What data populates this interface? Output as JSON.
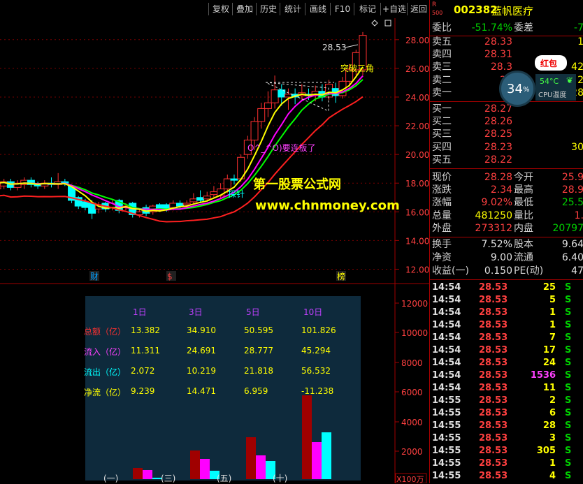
{
  "toolbar": {
    "buttons": [
      "复权",
      "叠加",
      "历史",
      "统计",
      "画线",
      "F10",
      "标记",
      "+自选",
      "返回"
    ]
  },
  "stock": {
    "prefix": "R",
    "code": "002382",
    "name": "蓝帆医疗",
    "sub": "500"
  },
  "price_axis": [
    "28.00",
    "26.00",
    "24.00",
    "22.00",
    "20.00",
    "18.00",
    "16.00",
    "14.00",
    "12.00"
  ],
  "vol_axis": [
    "12000",
    "10000",
    "8000",
    "6000",
    "4000",
    "2000"
  ],
  "vol_unit": "X100万",
  "annotations": {
    "high_price": "28.53",
    "breakout": "突破三角",
    "emoticon": "O^_^O)要连板了",
    "probe": "探针",
    "markers": [
      "财",
      "$",
      "榜"
    ]
  },
  "watermark": {
    "cn": "第一股票公式网",
    "url": "www.chnmoney.com"
  },
  "fund_table": {
    "headers": [
      "1日",
      "3日",
      "5日",
      "10日"
    ],
    "rows": [
      {
        "label": "总额（亿）",
        "values": [
          "13.382",
          "34.910",
          "50.595",
          "101.826"
        ]
      },
      {
        "label": "流入（亿）",
        "values": [
          "11.311",
          "24.691",
          "28.777",
          "45.294"
        ]
      },
      {
        "label": "流出（亿）",
        "values": [
          "2.072",
          "10.219",
          "21.818",
          "56.532"
        ]
      },
      {
        "label": "净流（亿）",
        "values": [
          "9.239",
          "14.471",
          "6.959",
          "-11.238"
        ]
      }
    ],
    "groups": [
      "(一)",
      "(三)",
      "(五)",
      "(十)"
    ],
    "bars": [
      {
        "total": 13.382,
        "inflow": 11.311,
        "outflow": 2.072
      },
      {
        "total": 34.91,
        "inflow": 24.691,
        "outflow": 10.219
      },
      {
        "total": 50.595,
        "inflow": 28.777,
        "outflow": 21.818
      },
      {
        "total": 101.826,
        "inflow": 45.294,
        "outflow": 56.532
      }
    ]
  },
  "quote": {
    "weibi_label": "委比",
    "weibi": "-51.74%",
    "weicha_label": "委差",
    "weicha": "-7",
    "asks": [
      {
        "label": "卖五",
        "price": "28.33",
        "vol": "1"
      },
      {
        "label": "卖四",
        "price": "28.31",
        "vol": ""
      },
      {
        "label": "卖三",
        "price": "28.3",
        "vol": "42"
      },
      {
        "label": "卖二",
        "price": "28",
        "vol": "2"
      },
      {
        "label": "卖一",
        "price": "28",
        "vol": "28"
      }
    ],
    "bids": [
      {
        "label": "买一",
        "price": "28.27",
        "vol": ""
      },
      {
        "label": "买二",
        "price": "28.26",
        "vol": ""
      },
      {
        "label": "买三",
        "price": "28.25",
        "vol": ""
      },
      {
        "label": "买四",
        "price": "28.23",
        "vol": "30"
      },
      {
        "label": "买五",
        "price": "28.22",
        "vol": ""
      }
    ],
    "stats": [
      {
        "l1": "现价",
        "v1": "28.28",
        "l2": "今开",
        "v2": "25.9"
      },
      {
        "l1": "涨跌",
        "v1": "2.34",
        "l2": "最高",
        "v2": "28.9"
      },
      {
        "l1": "涨幅",
        "v1": "9.02%",
        "l2": "最低",
        "v2": "25.5"
      },
      {
        "l1": "总量",
        "v1": "481250",
        "l2": "量比",
        "v2": "1."
      },
      {
        "l1": "外盘",
        "v1": "273312",
        "l2": "内盘",
        "v2": "20797"
      }
    ],
    "stats2": [
      {
        "l1": "换手",
        "v1": "7.52%",
        "l2": "股本",
        "v2": "9.64"
      },
      {
        "l1": "净资",
        "v1": "9.00",
        "l2": "流通",
        "v2": "6.40"
      },
      {
        "l1": "收益(一)",
        "v1": "0.150",
        "l2": "PE(动)",
        "v2": "47"
      }
    ]
  },
  "overlay": {
    "cpu_percent": "34",
    "cpu_unit": "%",
    "temp": "54°C",
    "temp_label": "CPU温度",
    "hongbao": "红包"
  },
  "ticks": [
    {
      "time": "14:54",
      "price": "28.53",
      "vol": "25",
      "bs": "S"
    },
    {
      "time": "14:54",
      "price": "28.53",
      "vol": "5",
      "bs": "S"
    },
    {
      "time": "14:54",
      "price": "28.53",
      "vol": "1",
      "bs": "S"
    },
    {
      "time": "14:54",
      "price": "28.53",
      "vol": "1",
      "bs": "S"
    },
    {
      "time": "14:54",
      "price": "28.53",
      "vol": "7",
      "bs": "S"
    },
    {
      "time": "14:54",
      "price": "28.53",
      "vol": "17",
      "bs": "S"
    },
    {
      "time": "14:54",
      "price": "28.53",
      "vol": "24",
      "bs": "S"
    },
    {
      "time": "14:54",
      "price": "28.53",
      "vol": "1536",
      "bs": "S"
    },
    {
      "time": "14:54",
      "price": "28.53",
      "vol": "11",
      "bs": "S"
    },
    {
      "time": "14:55",
      "price": "28.53",
      "vol": "2",
      "bs": "S"
    },
    {
      "time": "14:55",
      "price": "28.53",
      "vol": "6",
      "bs": "S"
    },
    {
      "time": "14:55",
      "price": "28.53",
      "vol": "28",
      "bs": "S"
    },
    {
      "time": "14:55",
      "price": "28.53",
      "vol": "3",
      "bs": "S"
    },
    {
      "time": "14:55",
      "price": "28.53",
      "vol": "305",
      "bs": "S"
    },
    {
      "time": "14:55",
      "price": "28.53",
      "vol": "1",
      "bs": "S"
    },
    {
      "time": "14:55",
      "price": "28.53",
      "vol": "4",
      "bs": "S"
    }
  ],
  "colors": {
    "up": "#ff3030",
    "down": "#00ffff",
    "ma5": "#ffffff",
    "ma10": "#ffff00",
    "ma20": "#ff00ff",
    "ma30": "#00ff00"
  },
  "chart_data": {
    "type": "candlestick",
    "ylim": [
      11,
      29.5
    ],
    "candles": [
      {
        "o": 17.6,
        "c": 18.0,
        "h": 18.4,
        "l": 17.4
      },
      {
        "o": 17.8,
        "c": 18.1,
        "h": 18.3,
        "l": 17.6
      },
      {
        "o": 18.1,
        "c": 17.7,
        "h": 18.3,
        "l": 17.5
      },
      {
        "o": 17.7,
        "c": 18.0,
        "h": 18.2,
        "l": 17.5
      },
      {
        "o": 17.9,
        "c": 18.2,
        "h": 18.4,
        "l": 17.6
      },
      {
        "o": 18.2,
        "c": 17.9,
        "h": 18.4,
        "l": 17.7
      },
      {
        "o": 17.9,
        "c": 17.8,
        "h": 18.1,
        "l": 17.6
      },
      {
        "o": 17.8,
        "c": 18.0,
        "h": 18.2,
        "l": 17.6
      },
      {
        "o": 18.0,
        "c": 17.9,
        "h": 18.4,
        "l": 17.7
      },
      {
        "o": 17.9,
        "c": 18.1,
        "h": 18.7,
        "l": 17.6
      },
      {
        "o": 18.1,
        "c": 18.0,
        "h": 18.3,
        "l": 17.8
      },
      {
        "o": 17.8,
        "c": 16.8,
        "h": 17.9,
        "l": 16.6
      },
      {
        "o": 17.0,
        "c": 16.4,
        "h": 17.1,
        "l": 16.2
      },
      {
        "o": 16.7,
        "c": 16.3,
        "h": 16.9,
        "l": 16.1
      },
      {
        "o": 16.6,
        "c": 15.9,
        "h": 16.8,
        "l": 15.5
      },
      {
        "o": 16.2,
        "c": 16.5,
        "h": 16.7,
        "l": 15.9
      },
      {
        "o": 16.6,
        "c": 16.2,
        "h": 16.7,
        "l": 16.0
      },
      {
        "o": 16.3,
        "c": 16.6,
        "h": 16.8,
        "l": 16.1
      },
      {
        "o": 16.8,
        "c": 16.1,
        "h": 16.9,
        "l": 15.9
      },
      {
        "o": 16.3,
        "c": 16.4,
        "h": 16.6,
        "l": 16.1
      },
      {
        "o": 16.6,
        "c": 15.8,
        "h": 16.7,
        "l": 15.6
      },
      {
        "o": 15.8,
        "c": 16.0,
        "h": 16.2,
        "l": 15.6
      },
      {
        "o": 16.3,
        "c": 15.9,
        "h": 16.5,
        "l": 15.7
      },
      {
        "o": 16.0,
        "c": 16.4,
        "h": 16.5,
        "l": 15.8
      },
      {
        "o": 16.5,
        "c": 16.2,
        "h": 16.6,
        "l": 16.0
      },
      {
        "o": 16.5,
        "c": 16.2,
        "h": 16.6,
        "l": 16.0
      },
      {
        "o": 16.3,
        "c": 16.6,
        "h": 16.8,
        "l": 16.1
      },
      {
        "o": 16.6,
        "c": 16.4,
        "h": 16.8,
        "l": 16.2
      },
      {
        "o": 16.5,
        "c": 16.6,
        "h": 16.8,
        "l": 16.3
      },
      {
        "o": 16.7,
        "c": 16.9,
        "h": 17.3,
        "l": 16.5
      },
      {
        "o": 17.0,
        "c": 16.8,
        "h": 17.5,
        "l": 16.6
      },
      {
        "o": 16.9,
        "c": 17.1,
        "h": 17.4,
        "l": 16.7
      },
      {
        "o": 17.2,
        "c": 17.4,
        "h": 17.8,
        "l": 17.0
      },
      {
        "o": 17.1,
        "c": 17.6,
        "h": 18.0,
        "l": 16.9
      },
      {
        "o": 17.6,
        "c": 18.3,
        "h": 18.6,
        "l": 17.3
      },
      {
        "o": 18.3,
        "c": 18.2,
        "h": 18.6,
        "l": 17.9
      },
      {
        "o": 18.3,
        "c": 19.8,
        "h": 20.0,
        "l": 18.1
      },
      {
        "o": 20.0,
        "c": 21.0,
        "h": 21.3,
        "l": 19.7
      },
      {
        "o": 21.0,
        "c": 22.3,
        "h": 22.6,
        "l": 20.3
      },
      {
        "o": 22.3,
        "c": 23.2,
        "h": 23.6,
        "l": 21.8
      },
      {
        "o": 23.2,
        "c": 23.6,
        "h": 24.4,
        "l": 22.6
      },
      {
        "o": 23.6,
        "c": 24.5,
        "h": 25.5,
        "l": 23.2
      },
      {
        "o": 24.5,
        "c": 24.0,
        "h": 24.9,
        "l": 23.4
      },
      {
        "o": 24.0,
        "c": 24.2,
        "h": 24.6,
        "l": 23.1
      },
      {
        "o": 24.2,
        "c": 24.0,
        "h": 24.6,
        "l": 23.5
      },
      {
        "o": 24.1,
        "c": 24.3,
        "h": 24.9,
        "l": 23.8
      },
      {
        "o": 24.2,
        "c": 24.1,
        "h": 24.6,
        "l": 23.8
      },
      {
        "o": 24.1,
        "c": 24.4,
        "h": 24.8,
        "l": 23.7
      },
      {
        "o": 24.4,
        "c": 24.0,
        "h": 24.9,
        "l": 23.7
      },
      {
        "o": 24.0,
        "c": 24.9,
        "h": 25.2,
        "l": 23.8
      },
      {
        "o": 24.6,
        "c": 24.1,
        "h": 25.0,
        "l": 23.6
      },
      {
        "o": 24.1,
        "c": 25.1,
        "h": 25.4,
        "l": 23.9
      },
      {
        "o": 25.1,
        "c": 25.9,
        "h": 26.3,
        "l": 24.8
      },
      {
        "o": 25.9,
        "c": 27.1,
        "h": 27.3,
        "l": 25.5
      },
      {
        "o": 25.9,
        "c": 28.3,
        "h": 28.53,
        "l": 25.5
      }
    ]
  }
}
